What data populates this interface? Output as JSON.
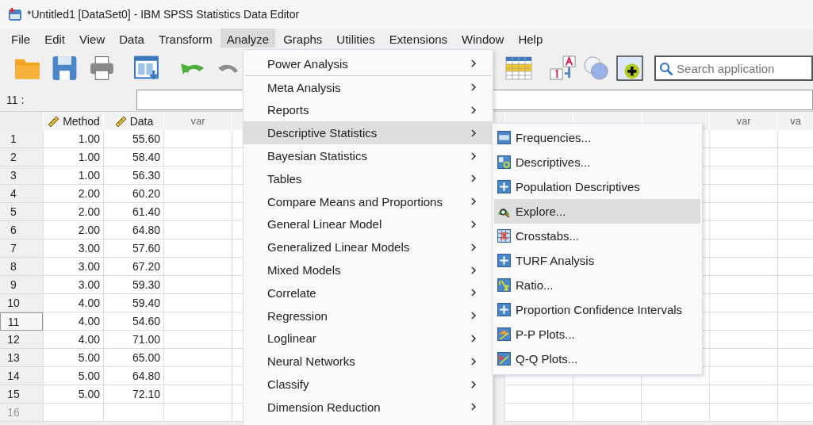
{
  "window": {
    "title": "*Untitled1 [DataSet0] - IBM SPSS Statistics Data Editor"
  },
  "menu_bar": [
    {
      "label": "File",
      "selected": false
    },
    {
      "label": "Edit",
      "selected": false
    },
    {
      "label": "View",
      "selected": false
    },
    {
      "label": "Data",
      "selected": false
    },
    {
      "label": "Transform",
      "selected": false
    },
    {
      "label": "Analyze",
      "selected": true
    },
    {
      "label": "Graphs",
      "selected": false
    },
    {
      "label": "Utilities",
      "selected": false
    },
    {
      "label": "Extensions",
      "selected": false
    },
    {
      "label": "Window",
      "selected": false
    },
    {
      "label": "Help",
      "selected": false
    }
  ],
  "toolbar": {
    "search": {
      "placeholder": "Search application"
    }
  },
  "cell_editor": {
    "cell_ref": "11 :"
  },
  "grid": {
    "columns": [
      {
        "label": "Method",
        "kind": "scale"
      },
      {
        "label": "Data",
        "kind": "scale"
      },
      {
        "label": "var",
        "kind": "empty"
      },
      {
        "kind": "hidden"
      },
      {
        "kind": "covered"
      },
      {
        "kind": "covered"
      },
      {
        "kind": "covered"
      },
      {
        "kind": "hidden"
      },
      {
        "kind": "hidden"
      },
      {
        "kind": "hidden"
      },
      {
        "label": "var",
        "kind": "empty"
      },
      {
        "label": "va",
        "kind": "empty"
      }
    ],
    "rows": [
      {
        "number": "1",
        "kind": "data",
        "selected": false,
        "values": [
          "1.00",
          "55.60"
        ]
      },
      {
        "number": "2",
        "kind": "data",
        "selected": false,
        "values": [
          "1.00",
          "58.40"
        ]
      },
      {
        "number": "3",
        "kind": "data",
        "selected": false,
        "values": [
          "1.00",
          "56.30"
        ]
      },
      {
        "number": "4",
        "kind": "data",
        "selected": false,
        "values": [
          "2.00",
          "60.20"
        ]
      },
      {
        "number": "5",
        "kind": "data",
        "selected": false,
        "values": [
          "2.00",
          "61.40"
        ]
      },
      {
        "number": "6",
        "kind": "data",
        "selected": false,
        "values": [
          "2.00",
          "64.80"
        ]
      },
      {
        "number": "7",
        "kind": "data",
        "selected": false,
        "values": [
          "3.00",
          "57.60"
        ]
      },
      {
        "number": "8",
        "kind": "data",
        "selected": false,
        "values": [
          "3.00",
          "67.20"
        ]
      },
      {
        "number": "9",
        "kind": "data",
        "selected": false,
        "values": [
          "3.00",
          "59.30"
        ]
      },
      {
        "number": "10",
        "kind": "data",
        "selected": false,
        "values": [
          "4.00",
          "59.40"
        ]
      },
      {
        "number": "11",
        "kind": "data",
        "selected": true,
        "values": [
          "4.00",
          "54.60"
        ]
      },
      {
        "number": "12",
        "kind": "data",
        "selected": false,
        "values": [
          "4.00",
          "71.00"
        ]
      },
      {
        "number": "13",
        "kind": "data",
        "selected": false,
        "values": [
          "5.00",
          "65.00"
        ]
      },
      {
        "number": "14",
        "kind": "data",
        "selected": false,
        "values": [
          "5.00",
          "64.80"
        ]
      },
      {
        "number": "15",
        "kind": "data",
        "selected": false,
        "values": [
          "5.00",
          "72.10"
        ]
      },
      {
        "number": "16",
        "kind": "new",
        "selected": false,
        "values": []
      }
    ]
  },
  "analyze_menu": [
    {
      "label": "Power Analysis",
      "selected": false,
      "divider": true
    },
    {
      "label": "Meta Analysis",
      "selected": false,
      "divider": false
    },
    {
      "label": "Reports",
      "selected": false,
      "divider": false
    },
    {
      "label": "Descriptive Statistics",
      "selected": true,
      "divider": false
    },
    {
      "label": "Bayesian Statistics",
      "selected": false,
      "divider": false
    },
    {
      "label": "Tables",
      "selected": false,
      "divider": false
    },
    {
      "label": "Compare Means and Proportions",
      "selected": false,
      "divider": false
    },
    {
      "label": "General Linear Model",
      "selected": false,
      "divider": false
    },
    {
      "label": "Generalized Linear Models",
      "selected": false,
      "divider": false
    },
    {
      "label": "Mixed Models",
      "selected": false,
      "divider": false
    },
    {
      "label": "Correlate",
      "selected": false,
      "divider": false
    },
    {
      "label": "Regression",
      "selected": false,
      "divider": false
    },
    {
      "label": "Loglinear",
      "selected": false,
      "divider": false
    },
    {
      "label": "Neural Networks",
      "selected": false,
      "divider": false
    },
    {
      "label": "Classify",
      "selected": false,
      "divider": false
    },
    {
      "label": "Dimension Reduction",
      "selected": false,
      "divider": false
    }
  ],
  "descriptive_submenu": [
    {
      "label": "Frequencies...",
      "kind": "frequencies",
      "selected": false
    },
    {
      "label": "Descriptives...",
      "kind": "descriptives",
      "selected": false
    },
    {
      "label": "Population Descriptives",
      "kind": "extension",
      "selected": false
    },
    {
      "label": "Explore...",
      "kind": "explore",
      "selected": true
    },
    {
      "label": "Crosstabs...",
      "kind": "crosstabs",
      "selected": false
    },
    {
      "label": "TURF Analysis",
      "kind": "extension",
      "selected": false
    },
    {
      "label": "Ratio...",
      "kind": "ratio",
      "selected": false
    },
    {
      "label": "Proportion Confidence Intervals",
      "kind": "extension",
      "selected": false
    },
    {
      "label": "P-P Plots...",
      "kind": "ppplot",
      "selected": false
    },
    {
      "label": "Q-Q Plots...",
      "kind": "qqplot",
      "selected": false
    }
  ]
}
